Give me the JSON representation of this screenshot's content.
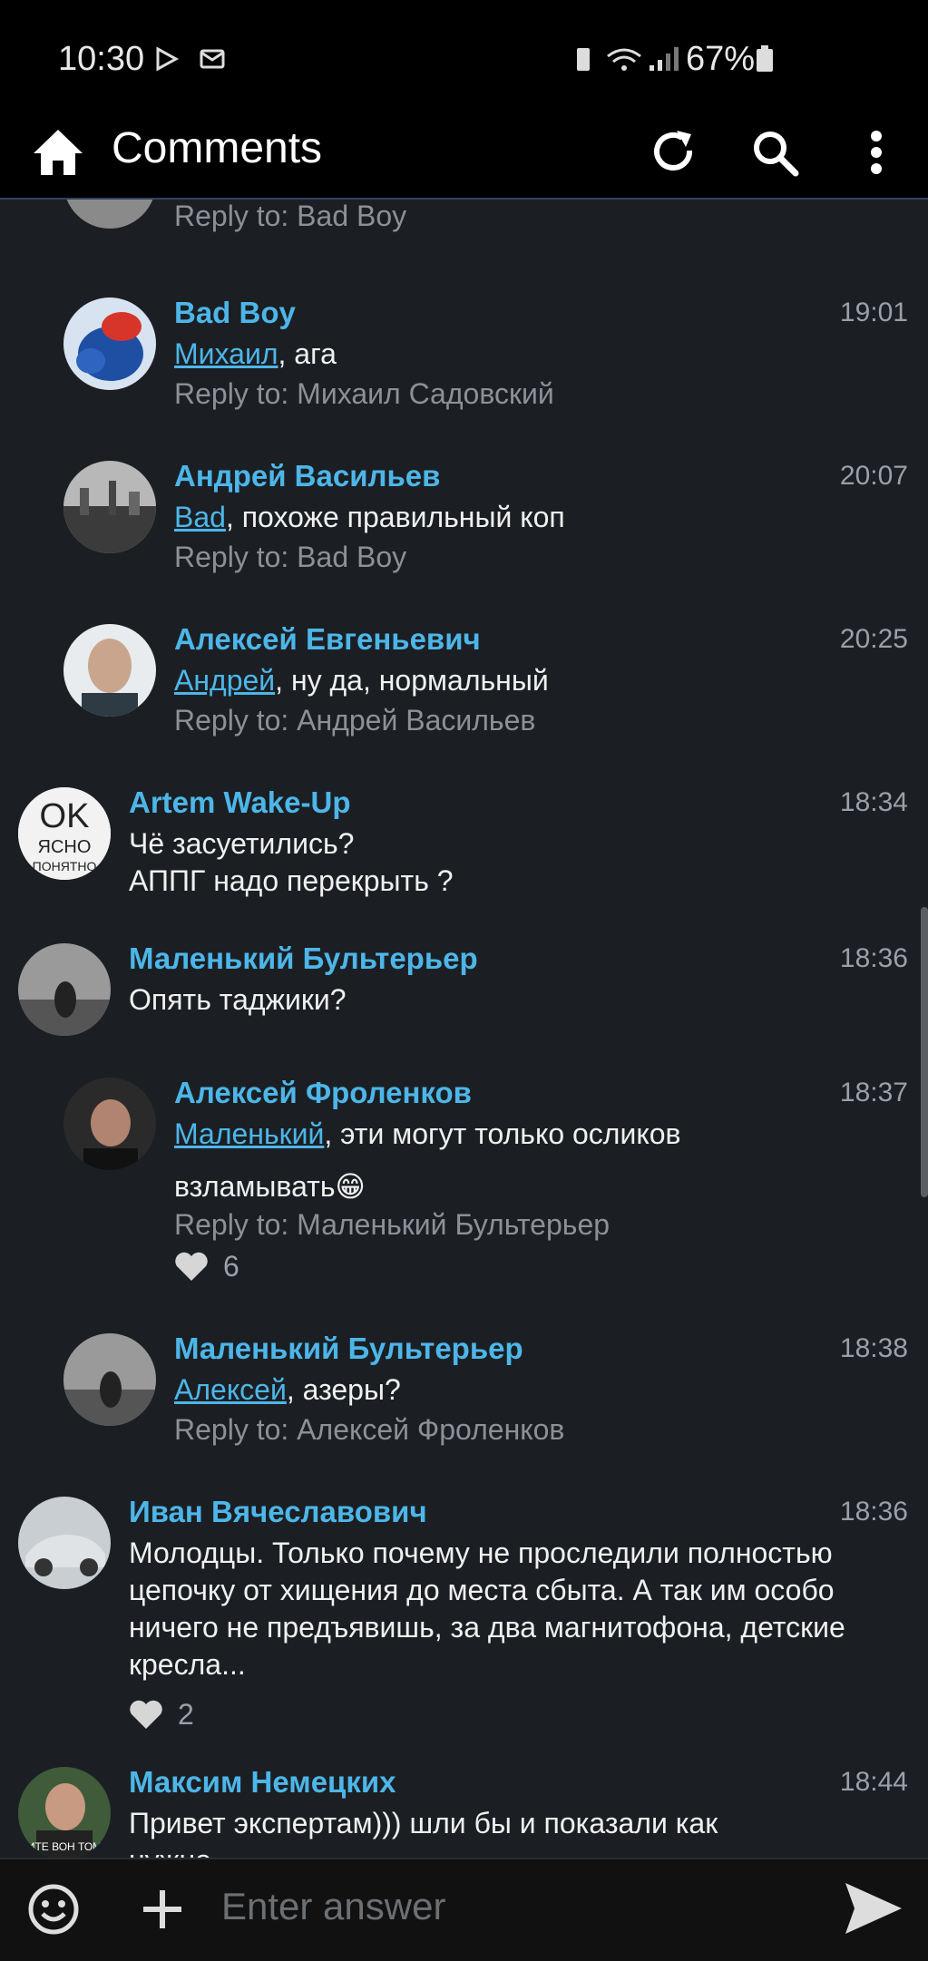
{
  "status_bar": {
    "time": "10:30",
    "battery": "67%"
  },
  "appbar": {
    "title": "Comments",
    "icons": [
      "home-icon",
      "refresh-icon",
      "search-icon",
      "more-icon"
    ]
  },
  "comments": [
    {
      "reply_to": "Reply to: Bad Boy"
    },
    {
      "author": "Bad Boy",
      "time": "19:01",
      "mention": "Михаил",
      "text": ", ага",
      "reply_to": "Reply to: Михаил Садовский"
    },
    {
      "author": "Андрей Васильев",
      "time": "20:07",
      "mention": "Bad",
      "text": ", похоже правильный коп",
      "reply_to": "Reply to: Bad Boy"
    },
    {
      "author": "Алексей Евгеньевич",
      "time": "20:25",
      "mention": "Андрей",
      "text": ", ну да, нормальный",
      "reply_to": "Reply to: Андрей Васильев"
    },
    {
      "author": "Artem Wake-Up",
      "time": "18:34",
      "line1": "Чё засуетились?",
      "line2": "АППГ надо перекрыть ?"
    },
    {
      "author": "Маленький Бультерьер",
      "time": "18:36",
      "text": "Опять таджики?"
    },
    {
      "author": "Алексей Фроленков",
      "time": "18:37",
      "mention": "Маленький",
      "text": ", эти могут только осликов",
      "line2": "взламывать😁",
      "reply_to": "Reply to: Маленький Бультерьер",
      "likes": "6"
    },
    {
      "author": "Маленький Бультерьер",
      "time": "18:38",
      "mention": "Алексей",
      "text": ", азеры?",
      "reply_to": "Reply to: Алексей Фроленков"
    },
    {
      "author": "Иван Вячеславович",
      "time": "18:36",
      "text": "Молодцы. Только почему не проследили полностью цепочку от хищения до места сбыта. А так им особо ничего не предъявишь, за два магнитофона, детские кресла...",
      "likes": "2"
    },
    {
      "author": "Максим Немецких",
      "time": "18:44",
      "text": "Привет экспертам))) шли бы и показали как нужно...."
    }
  ],
  "avatar_texts": {
    "artem": [
      "OK",
      "ЯСНО",
      "ПОНЯТНО"
    ],
    "maksim": "ИТЕ ВОН ТОМ"
  },
  "input": {
    "placeholder": "Enter answer"
  },
  "colors": {
    "accent": "#4db6e8",
    "background": "#1b1f24",
    "bar": "#000000"
  }
}
